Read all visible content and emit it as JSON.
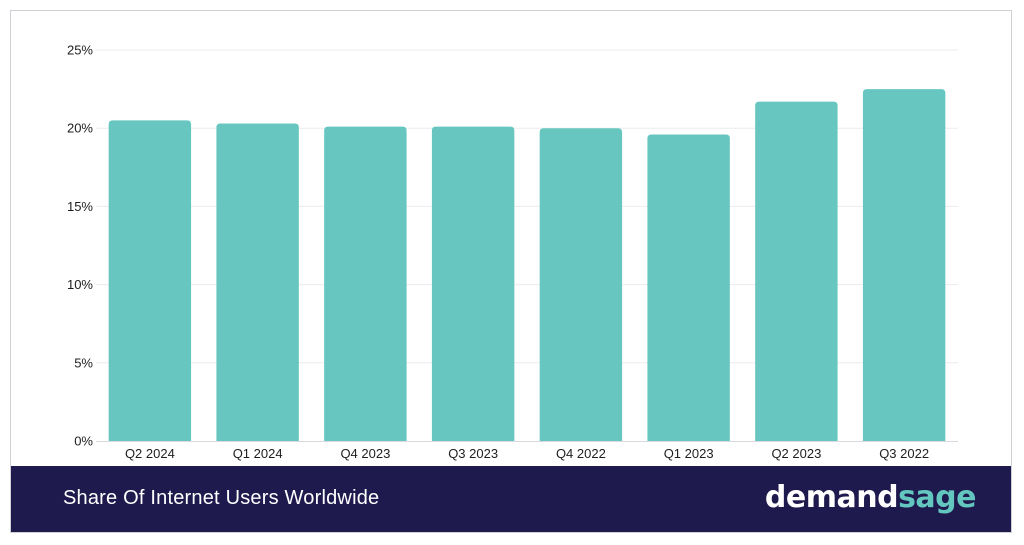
{
  "chart_data": {
    "type": "bar",
    "categories": [
      "Q2 2024",
      "Q1 2024",
      "Q4 2023",
      "Q3 2023",
      "Q4 2022",
      "Q1 2023",
      "Q2 2023",
      "Q3 2022"
    ],
    "values": [
      20.5,
      20.3,
      20.1,
      20.1,
      20.0,
      19.6,
      21.7,
      22.5
    ],
    "y_ticks": [
      "0%",
      "5%",
      "10%",
      "15%",
      "20%",
      "25%"
    ],
    "ylim": [
      0,
      25
    ],
    "grid": true,
    "bar_color": "#67c6c0"
  },
  "footer": {
    "title": "Share Of Internet Users Worldwide",
    "brand_part_1": "demand",
    "brand_part_2": "sage",
    "background": "#1f1a4d",
    "brand_accent": "#63c7c0"
  }
}
